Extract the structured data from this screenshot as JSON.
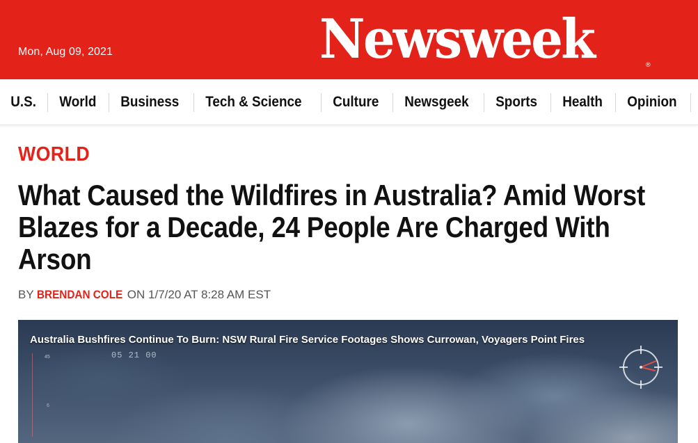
{
  "header": {
    "date": "Mon, Aug 09, 2021",
    "logo": "Newsweek",
    "logo_mark": "®",
    "background_color": "#e32219"
  },
  "nav": {
    "items": [
      {
        "label": "U.S."
      },
      {
        "label": "World"
      },
      {
        "label": "Business"
      },
      {
        "label": "Tech & Science"
      },
      {
        "label": "Culture"
      },
      {
        "label": "Newsgeek"
      },
      {
        "label": "Sports"
      },
      {
        "label": "Health"
      },
      {
        "label": "Opinion"
      }
    ]
  },
  "article": {
    "section": "WORLD",
    "headline": "What Caused the Wildfires in Australia? Amid Worst Blazes for a Decade, 24 People Are Charged With Arson",
    "byline_prefix": "BY",
    "author": "BRENDAN COLE",
    "byline_suffix": "ON 1/7/20 AT 8:28 AM EST",
    "accent_color": "#e32219"
  },
  "video": {
    "title": "Australia Bushfires Continue To Burn: NSW Rural Fire Service Footages Shows Currowan, Voyagers Point Fires",
    "timestamp": "05 21 00",
    "altitude_label": "45",
    "scale_label": "6"
  },
  "icons": {
    "compass": "compass-icon"
  }
}
